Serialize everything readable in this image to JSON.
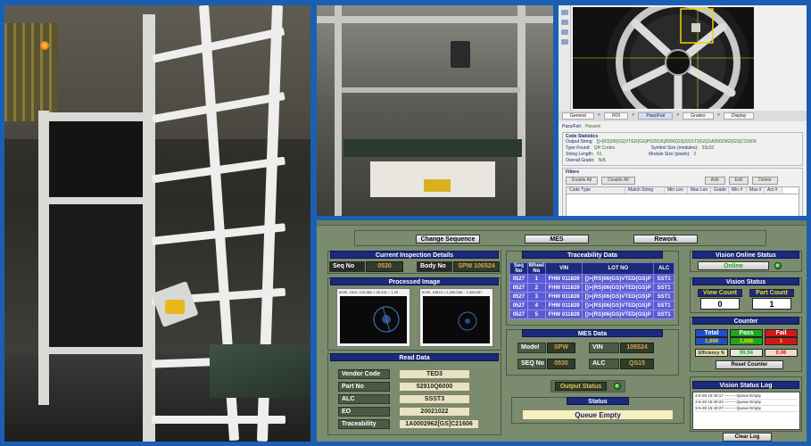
{
  "vision_software": {
    "tabs": [
      "General",
      "ROI",
      "Pass/Fail",
      "Grades",
      "Display"
    ],
    "active_tab": "Pass/Fail",
    "pass_fail_label": "Pass/Fail:",
    "pass_fail_value": "Passed",
    "code_statistics_title": "Code Statistics",
    "output_string_label": "Output String:",
    "output_string_value": "[]>{RS}06{GS}VTED{GS}P52910Q6000{GS}SSST3{GS}1A0002962{GS}C21606",
    "type_found_label": "Type Found:",
    "type_found_value": "QR Codes",
    "symbol_size_label": "Symbol Size (modules):",
    "symbol_size_value": "33x33",
    "string_length_label": "String Length:",
    "string_length_value": "61",
    "module_size_label": "Module Size (pixels):",
    "module_size_value": "2",
    "overall_grade_label": "Overall Grade:",
    "overall_grade_value": "N/A",
    "filters_title": "Filters",
    "filter_buttons": [
      "Enable All",
      "Disable All"
    ],
    "filter_actions": [
      "Add",
      "Edit",
      "Delete"
    ],
    "filter_columns": [
      "Code Type",
      "Match String",
      "Min Len",
      "Max Len",
      "Grade",
      "Min #",
      "Max #",
      "Act #"
    ]
  },
  "hmi": {
    "top_buttons": {
      "change_sequence": "Change Sequence",
      "mes": "MES",
      "rework": "Rework"
    },
    "current_inspection": {
      "title": "Current Inspection Details",
      "seq_label": "Seq No",
      "seq_value": "0530",
      "body_label": "Body No",
      "body_value": "SPW 106524"
    },
    "processed_image": {
      "title": "Processed Image",
      "left_caption": "819E, 1519, 122.862 > 33.431 ~ 1.29",
      "right_caption": "819E, 19819 > 2,455.096 ~ 1,908.537"
    },
    "traceability": {
      "title": "Traceability Data",
      "columns": [
        "Seq No",
        "Wheel No",
        "VIN",
        "LOT NO",
        "ALC"
      ],
      "rows": [
        [
          "0527",
          "1",
          "FHW 011839",
          "[)>{RS}06{GS}VTED{GS}P",
          "SST1"
        ],
        [
          "0527",
          "2",
          "FHW 011839",
          "[)>{RS}06{GS}VTED{GS}P",
          "SST1"
        ],
        [
          "0527",
          "3",
          "FHW 011839",
          "[)>{RS}06{GS}VTED{GS}P",
          "SST1"
        ],
        [
          "0527",
          "4",
          "FHW 011839",
          "[)>{RS}06{GS}VTED{GS}P",
          "SST1"
        ],
        [
          "0527",
          "5",
          "FHW 011839",
          "[)>{RS}06{GS}VTED{GS}P",
          "SST1"
        ]
      ]
    },
    "mes_data": {
      "title": "MES Data",
      "model_label": "Model",
      "model_value": "SPW",
      "vin_label": "VIN",
      "vin_value": "106524",
      "seq_label": "SEQ No",
      "seq_value": "0530",
      "alc_label": "ALC",
      "alc_value": "QS15"
    },
    "read_data": {
      "title": "Read Data",
      "fields": [
        {
          "label": "Vendor Code",
          "value": "TED3"
        },
        {
          "label": "Part No",
          "value": "52910Q6000"
        },
        {
          "label": "ALC",
          "value": "SSST3"
        },
        {
          "label": "EO",
          "value": "20021022"
        },
        {
          "label": "Traceability",
          "value": "1A0002962[GS]C21606"
        }
      ]
    },
    "output_status_label": "Output Status",
    "status": {
      "title": "Status",
      "value": "Queue Empty"
    },
    "vision_online": {
      "title": "Vision Online Status",
      "button": "Online"
    },
    "vision_status": {
      "title": "Vision Status",
      "view_count_label": "View Count",
      "view_count_value": "0",
      "part_count_label": "Part Count",
      "part_count_value": "1"
    },
    "counter": {
      "title": "Counter",
      "total_label": "Total",
      "total_value": "1,669",
      "pass_label": "Pass",
      "pass_value": "1,668",
      "fail_label": "Fail",
      "fail_value": "1",
      "efficiency_label": "Efficiency %",
      "efficiency_value": "99.94",
      "efficiency_fail": "0.06",
      "reset_button": "Reset Counter"
    },
    "vision_log": {
      "title": "Vision Status Log",
      "entries": [
        "3-6-28 15:40:17 ---------Queue Empty",
        "3-6-28 15:40:22 ---------Queue Empty",
        "3-6-28 15:40:27 ---------Queue Empty"
      ],
      "clear_button": "Clear Log"
    },
    "colors": {
      "header_blue": "#1b2a7a",
      "panel_bg": "#7a8b6e",
      "table_row": "#5a5ad4",
      "total_blue": "#1f4fc8",
      "pass_green": "#1fa51f",
      "fail_red": "#d01a1a",
      "value_orange": "#d8a24a"
    }
  }
}
